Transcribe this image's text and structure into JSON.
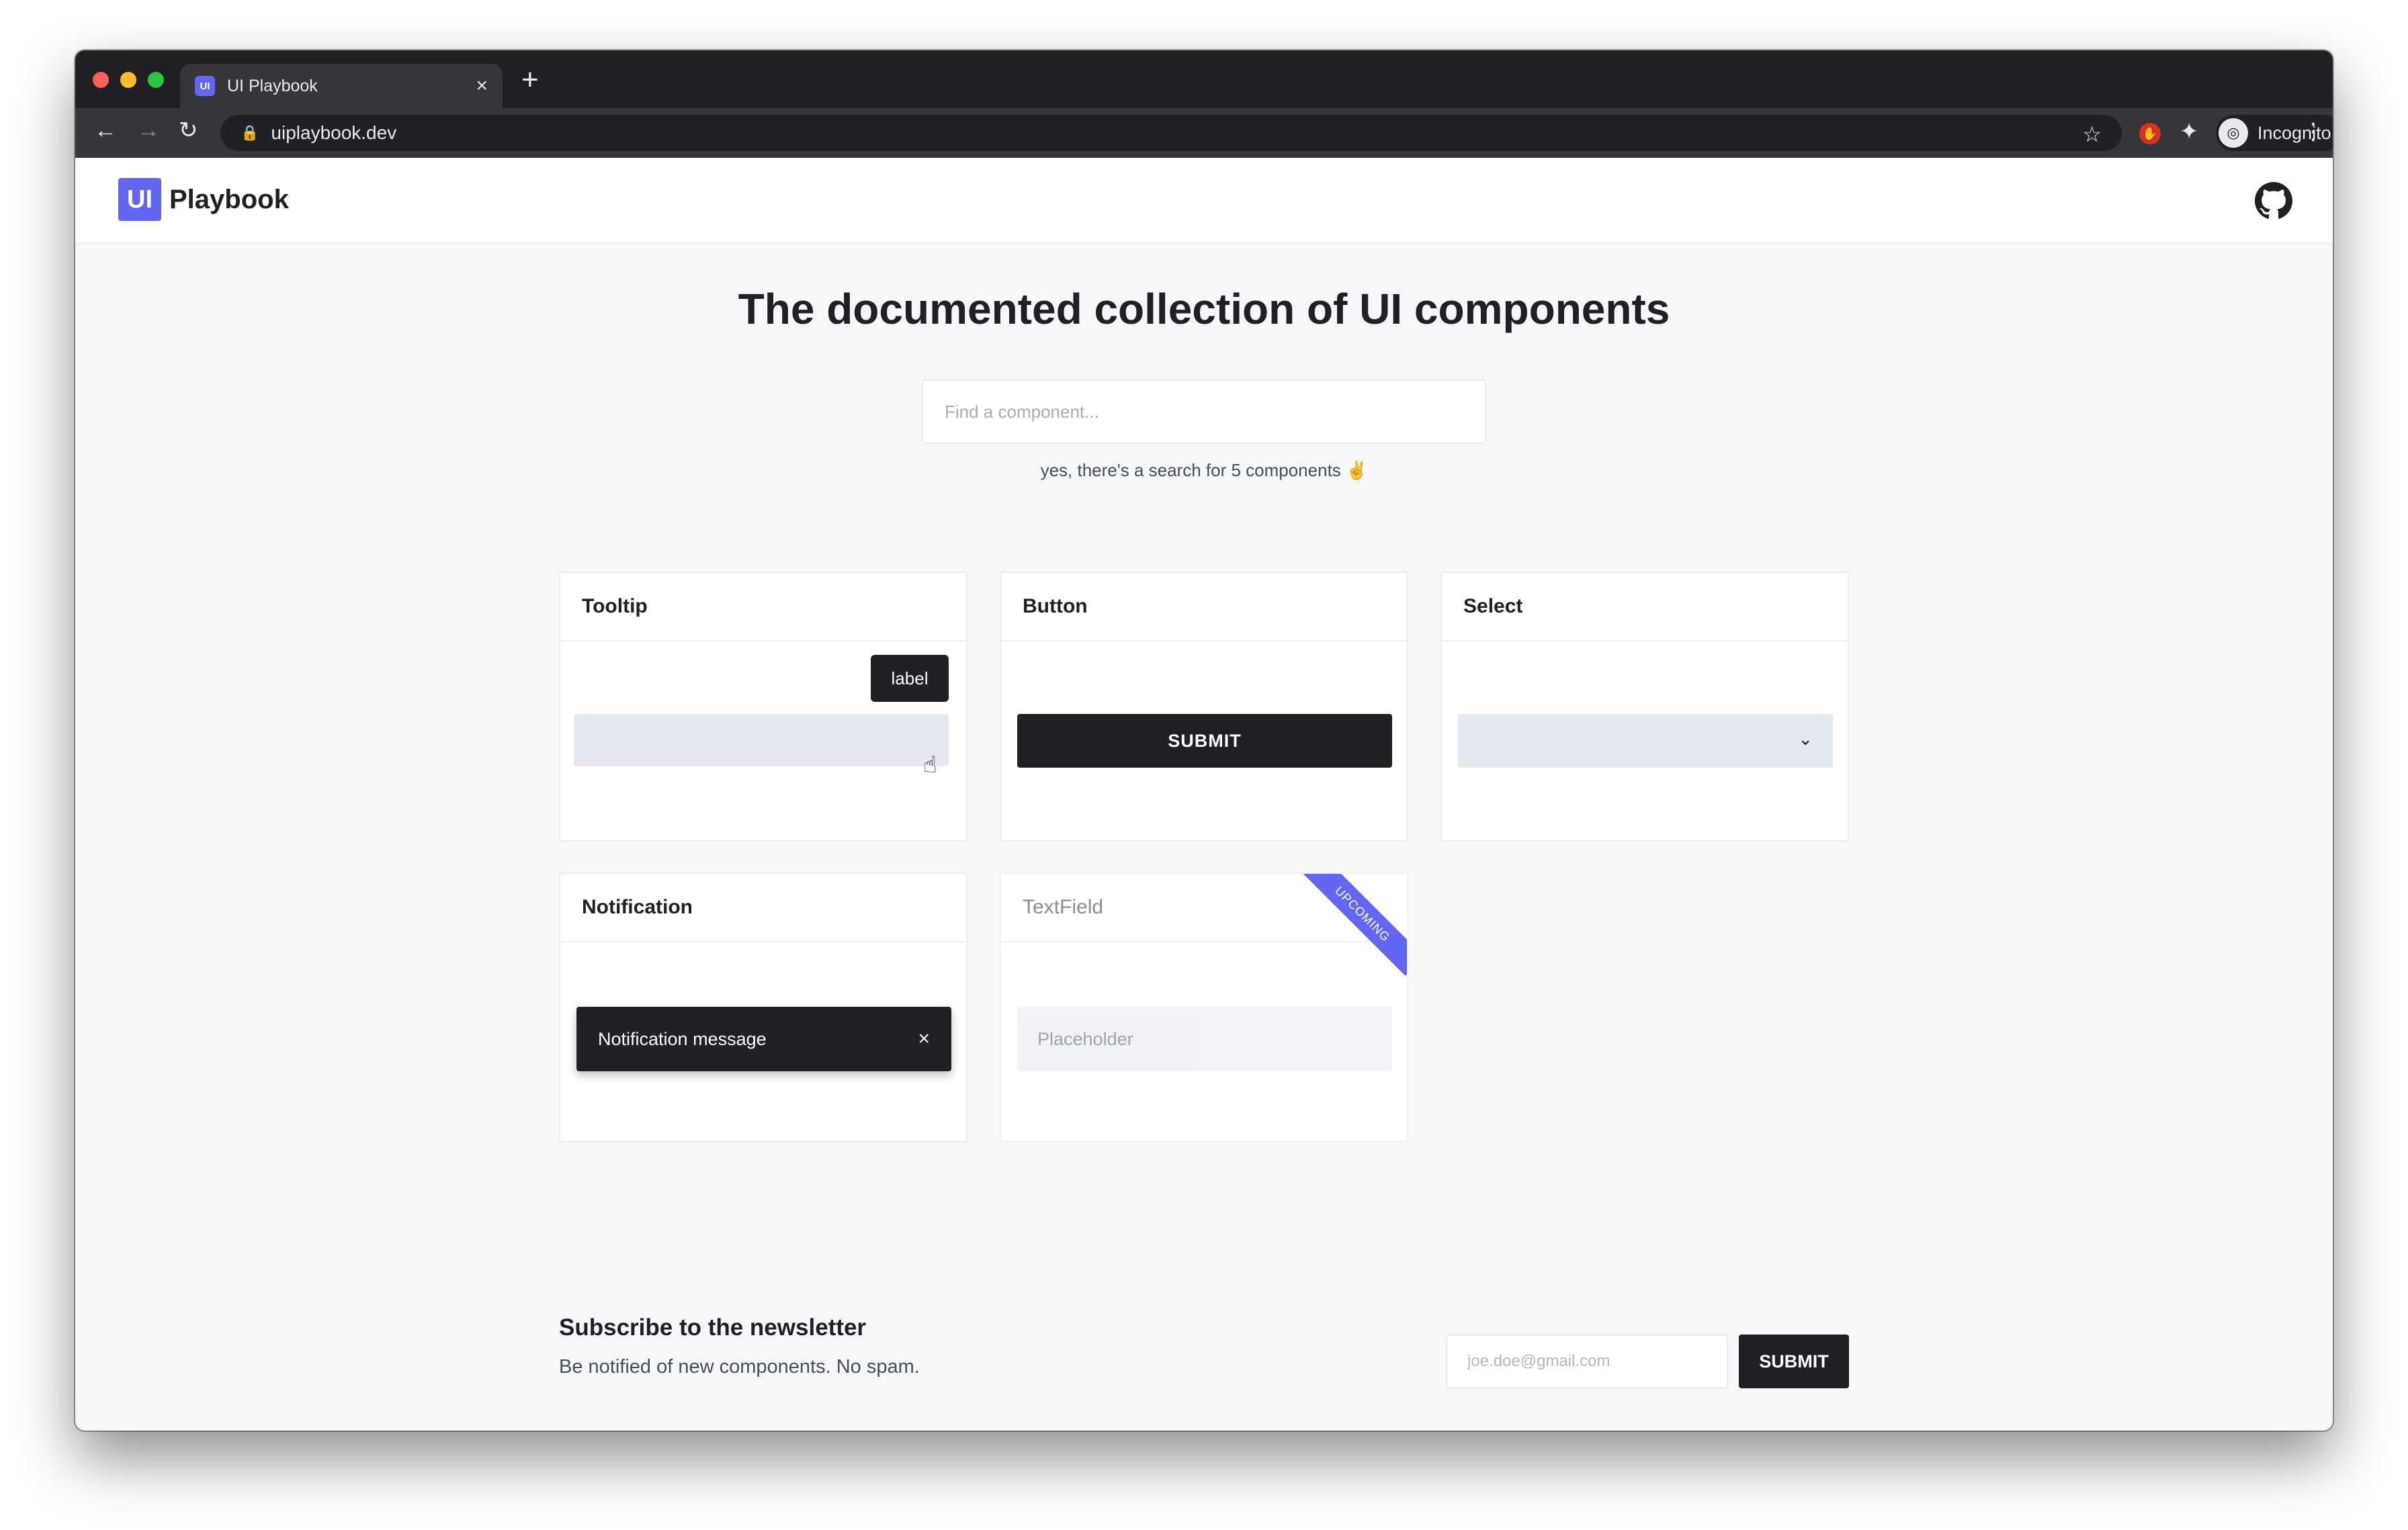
{
  "browser": {
    "tab_title": "UI Playbook",
    "tab_favicon": "UI",
    "tab_close": "×",
    "new_tab": "+",
    "url": "uiplaybook.dev",
    "profile_label": "Incognito",
    "icons": [
      "back-icon",
      "forward-icon",
      "reload-icon",
      "lock-icon",
      "star-icon",
      "extension-icon",
      "puzzle-icon",
      "incognito-icon",
      "menu-icon"
    ]
  },
  "site": {
    "logo_mark": "UI",
    "logo_text": "Playbook",
    "github_icon": "github-icon"
  },
  "hero": {
    "title": "The documented collection of UI components",
    "search_placeholder": "Find a component...",
    "search_note": "yes, there's a search for 5 components ✌️"
  },
  "cards": {
    "tooltip": {
      "title": "Tooltip",
      "tooltip_label": "label"
    },
    "button": {
      "title": "Button",
      "button_label": "SUBMIT"
    },
    "select": {
      "title": "Select"
    },
    "notification": {
      "title": "Notification",
      "message": "Notification message",
      "close": "×"
    },
    "textfield": {
      "title": "TextField",
      "placeholder": "Placeholder",
      "ribbon": "Upcoming"
    }
  },
  "newsletter": {
    "title": "Subscribe to the newsletter",
    "subtitle": "Be notified of new components. No spam.",
    "email_placeholder": "joe.doe@gmail.com",
    "button_label": "SUBMIT"
  },
  "colors": {
    "accent": "#6366f1",
    "dark": "#1f2023",
    "chrome": "#35363a"
  }
}
